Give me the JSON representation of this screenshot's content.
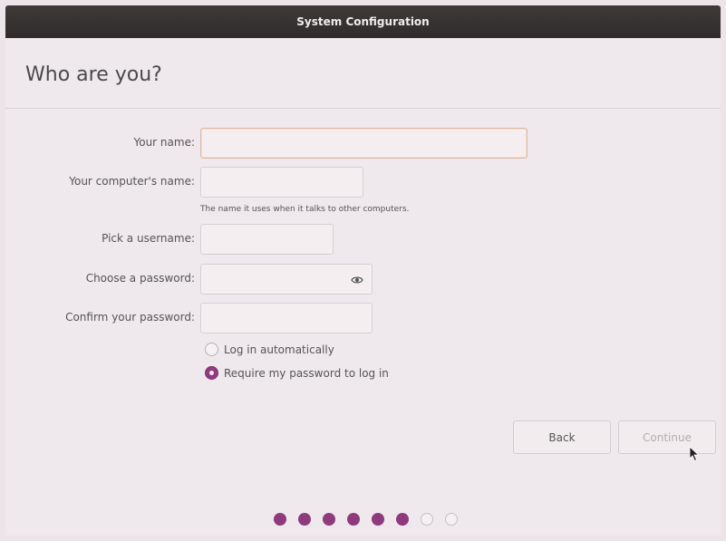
{
  "window": {
    "title": "System Configuration"
  },
  "page": {
    "heading": "Who are you?"
  },
  "form": {
    "your_name": {
      "label": "Your name:",
      "value": ""
    },
    "computer_name": {
      "label": "Your computer's name:",
      "value": "",
      "hint": "The name it uses when it talks to other computers."
    },
    "username": {
      "label": "Pick a username:",
      "value": ""
    },
    "password": {
      "label": "Choose a password:",
      "value": ""
    },
    "confirm_password": {
      "label": "Confirm your password:",
      "value": ""
    },
    "login_options": [
      {
        "label": "Log in automatically",
        "selected": false
      },
      {
        "label": "Require my password to log in",
        "selected": true
      }
    ]
  },
  "buttons": {
    "back": "Back",
    "continue": "Continue"
  },
  "progress": {
    "total_steps": 8,
    "completed_steps": 6
  },
  "colors": {
    "accent": "#8e3a7d",
    "titlebar": "#33302e",
    "background": "#efe8ec"
  },
  "icons": {
    "password_toggle": "eye-icon"
  }
}
